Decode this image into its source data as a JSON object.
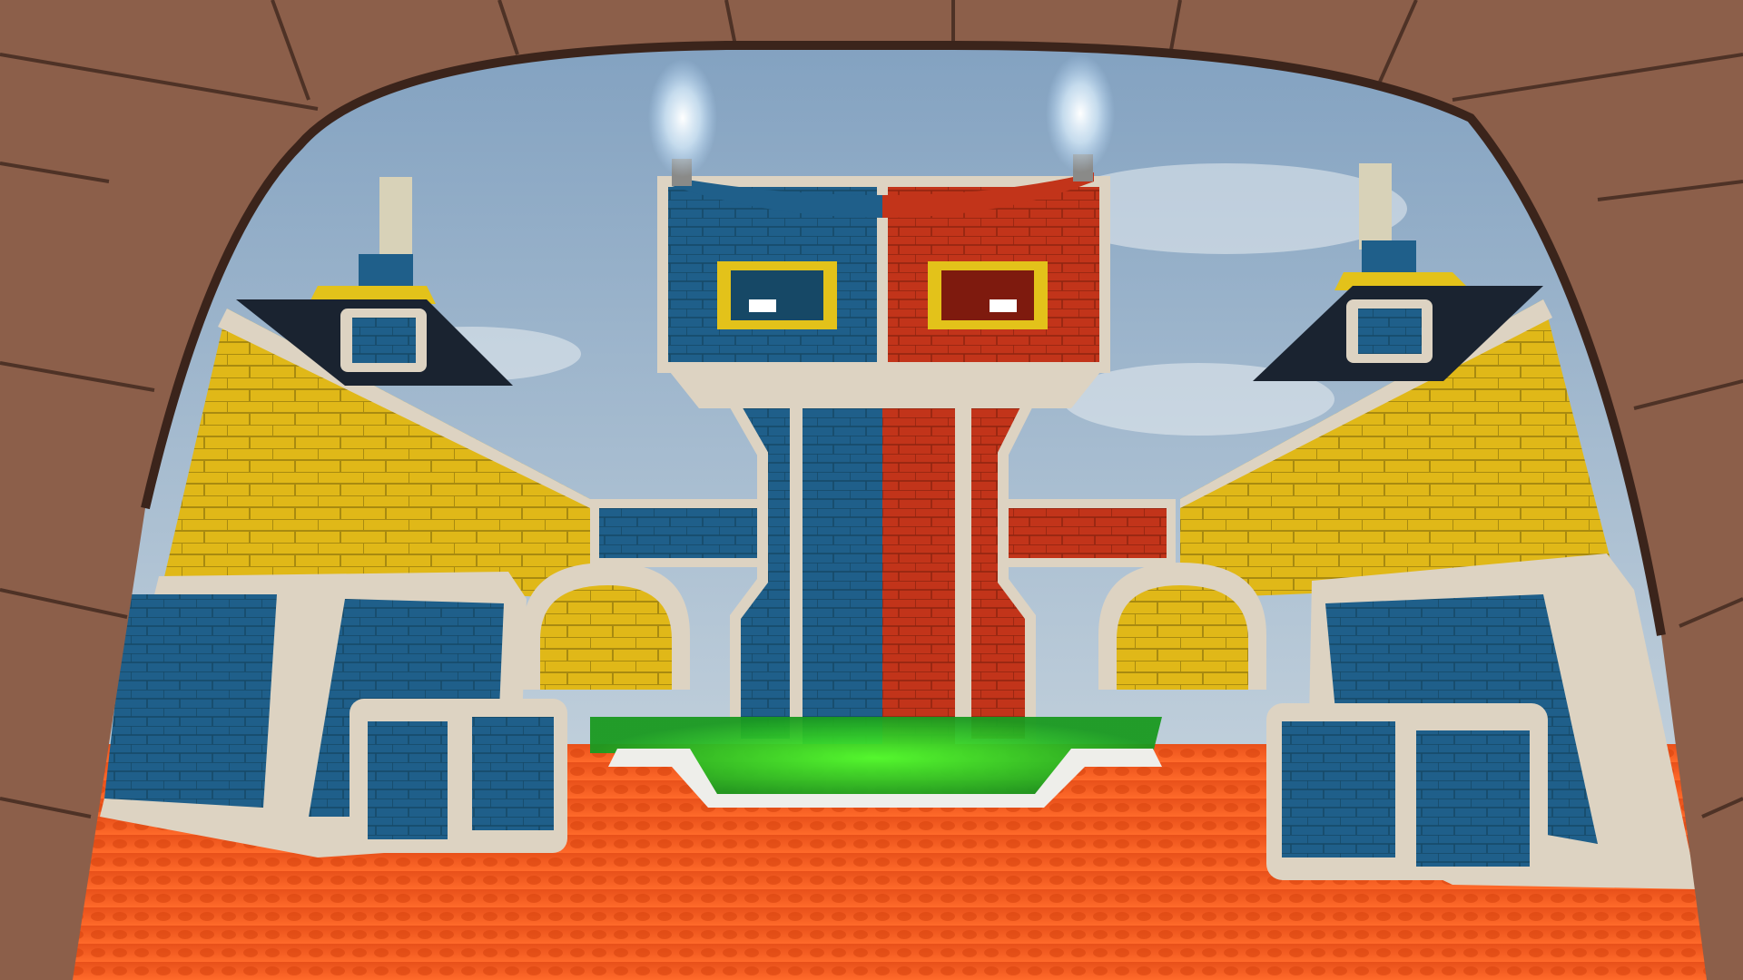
{
  "scene": {
    "colors": {
      "sky_top": "#7f9fbf",
      "sky_bottom": "#c9d6df",
      "arch_stone": "#8c5f4a",
      "arch_stone_dark": "#5e3d30",
      "wall_yellow": "#e0b818",
      "wall_yellow_dark": "#a88a10",
      "tower_blue": "#1f5f8a",
      "tower_red": "#c2341a",
      "trim_beige": "#ddd3c2",
      "floor_orange": "#f0541c",
      "pool_green": "#33d62a",
      "eye_yellow": "#e3c21a",
      "light_glow": "#ffffff"
    }
  }
}
